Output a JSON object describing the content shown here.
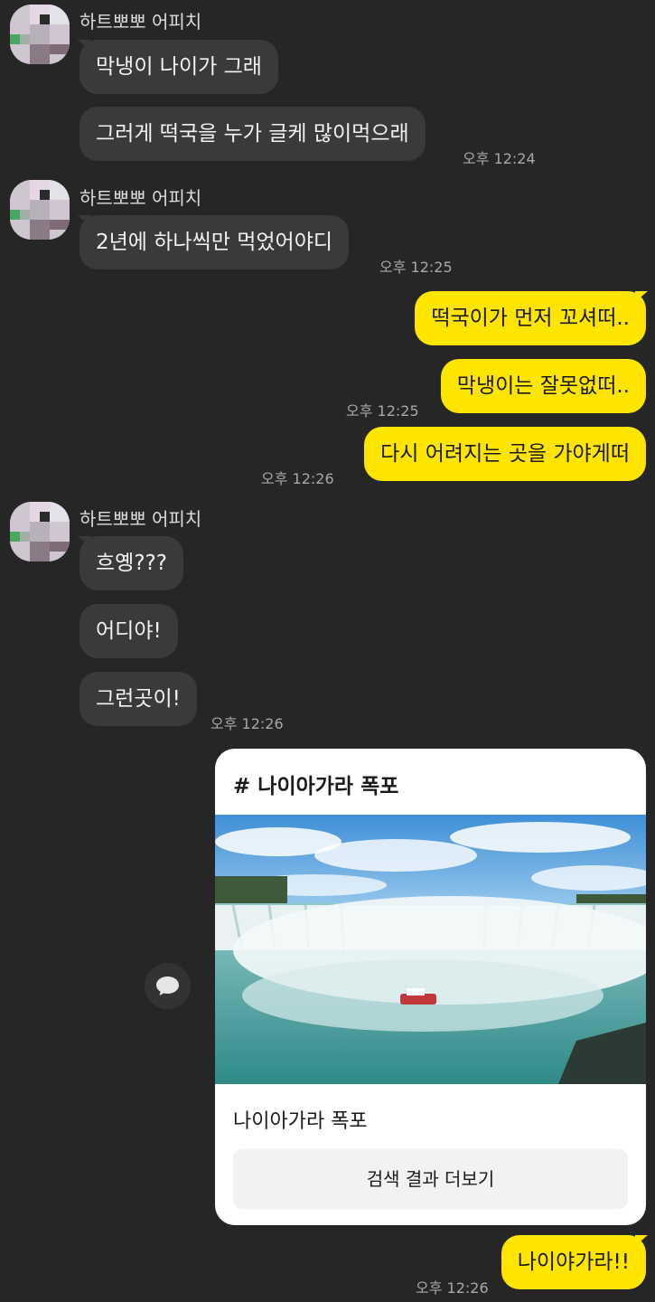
{
  "sender_name": "하트뽀뽀 어피치",
  "messages": {
    "m1": "막냉이 나이가 그래",
    "m2": "그러게 떡국을 누가 글케 많이먹으래",
    "t2": "오후 12:24",
    "m3": "2년에 하나씩만 먹었어야디",
    "t3": "오후 12:25",
    "o1": "떡국이가 먼저 꼬셔떠..",
    "o2": "막냉이는 잘못없떠..",
    "to2": "오후 12:25",
    "o3": "다시 어려지는 곳을 가야게떠",
    "to3": "오후 12:26",
    "m4": "흐옝???",
    "m5": "어디야!",
    "m6": "그런곳이!",
    "t6": "오후 12:26",
    "o4": "나이야가라!!",
    "to4": "오후 12:26"
  },
  "card": {
    "title": "# 나이아가라 폭포",
    "caption": "나이아가라 폭포",
    "button": "검색 결과 더보기"
  },
  "icons": {
    "share": "speech-bubble-icon",
    "avatar": "pixelated-profile-icon"
  },
  "colors": {
    "background": "#262626",
    "incoming_bubble": "#3a3a3a",
    "outgoing_bubble": "#fee500"
  }
}
